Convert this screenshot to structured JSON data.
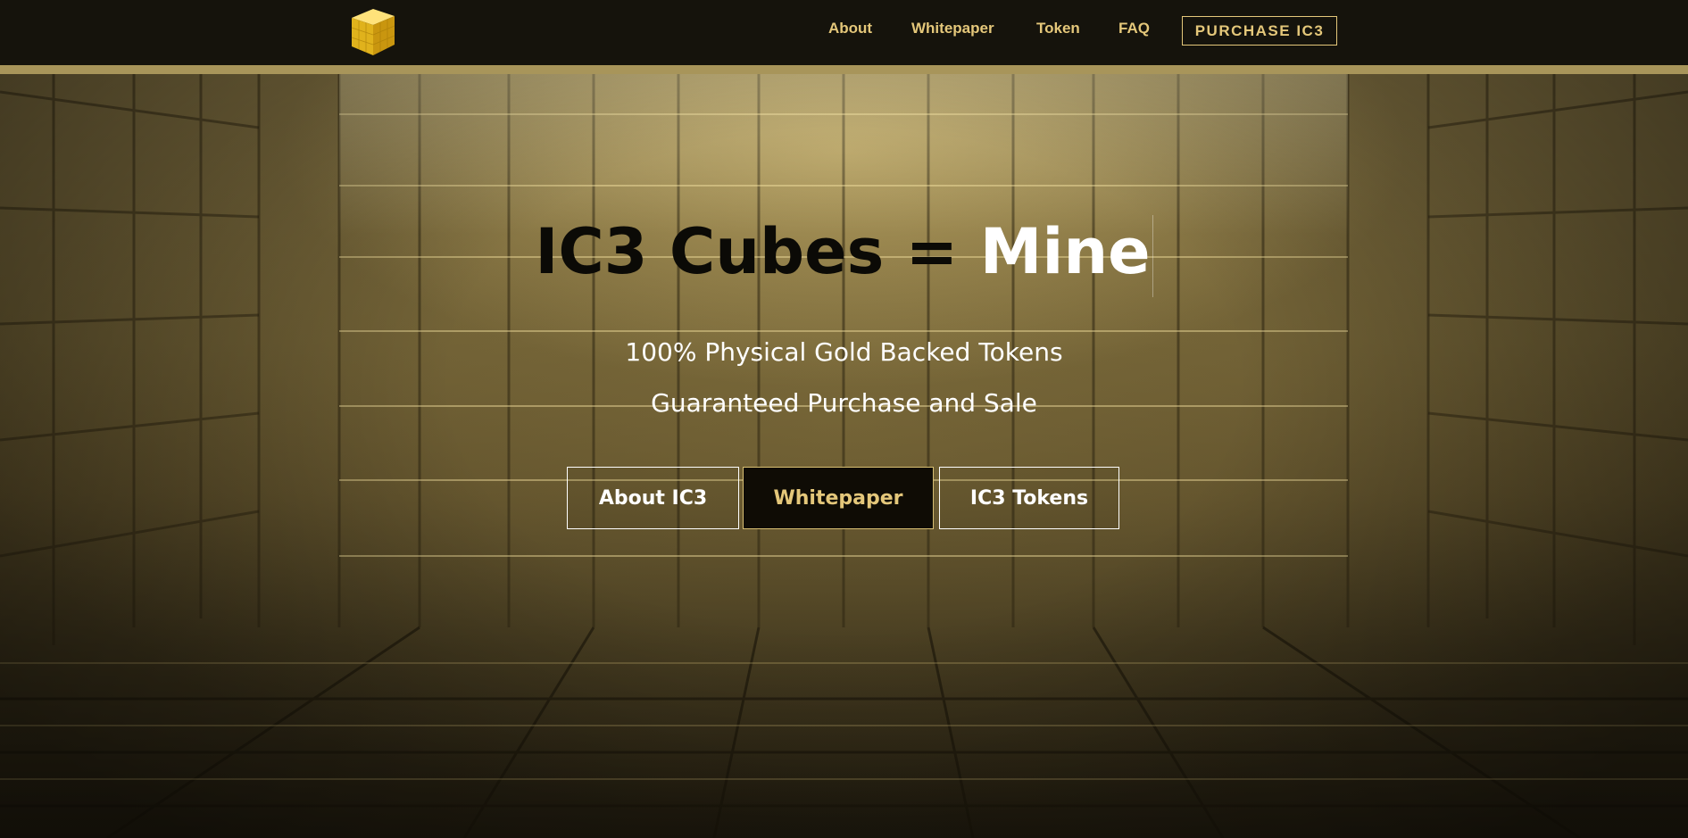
{
  "nav": {
    "logo_icon": "gold-cube-icon",
    "links": [
      {
        "label": "About"
      },
      {
        "label": "Whitepaper"
      },
      {
        "label": "Token"
      },
      {
        "label": "FAQ"
      }
    ],
    "cta_label": "PURCHASE IC3"
  },
  "hero": {
    "title_part1": "IC3 Cubes = ",
    "title_part2": "Mine",
    "subtitle1": "100% Physical Gold Backed Tokens",
    "subtitle2": "Guaranteed Purchase and Sale",
    "buttons": [
      {
        "label": "About IC3"
      },
      {
        "label": "Whitepaper"
      },
      {
        "label": "IC3 Tokens"
      }
    ]
  },
  "colors": {
    "accent_gold": "#e4c77a",
    "nav_background": "#15130c",
    "accent_bar": "#a8955a"
  }
}
